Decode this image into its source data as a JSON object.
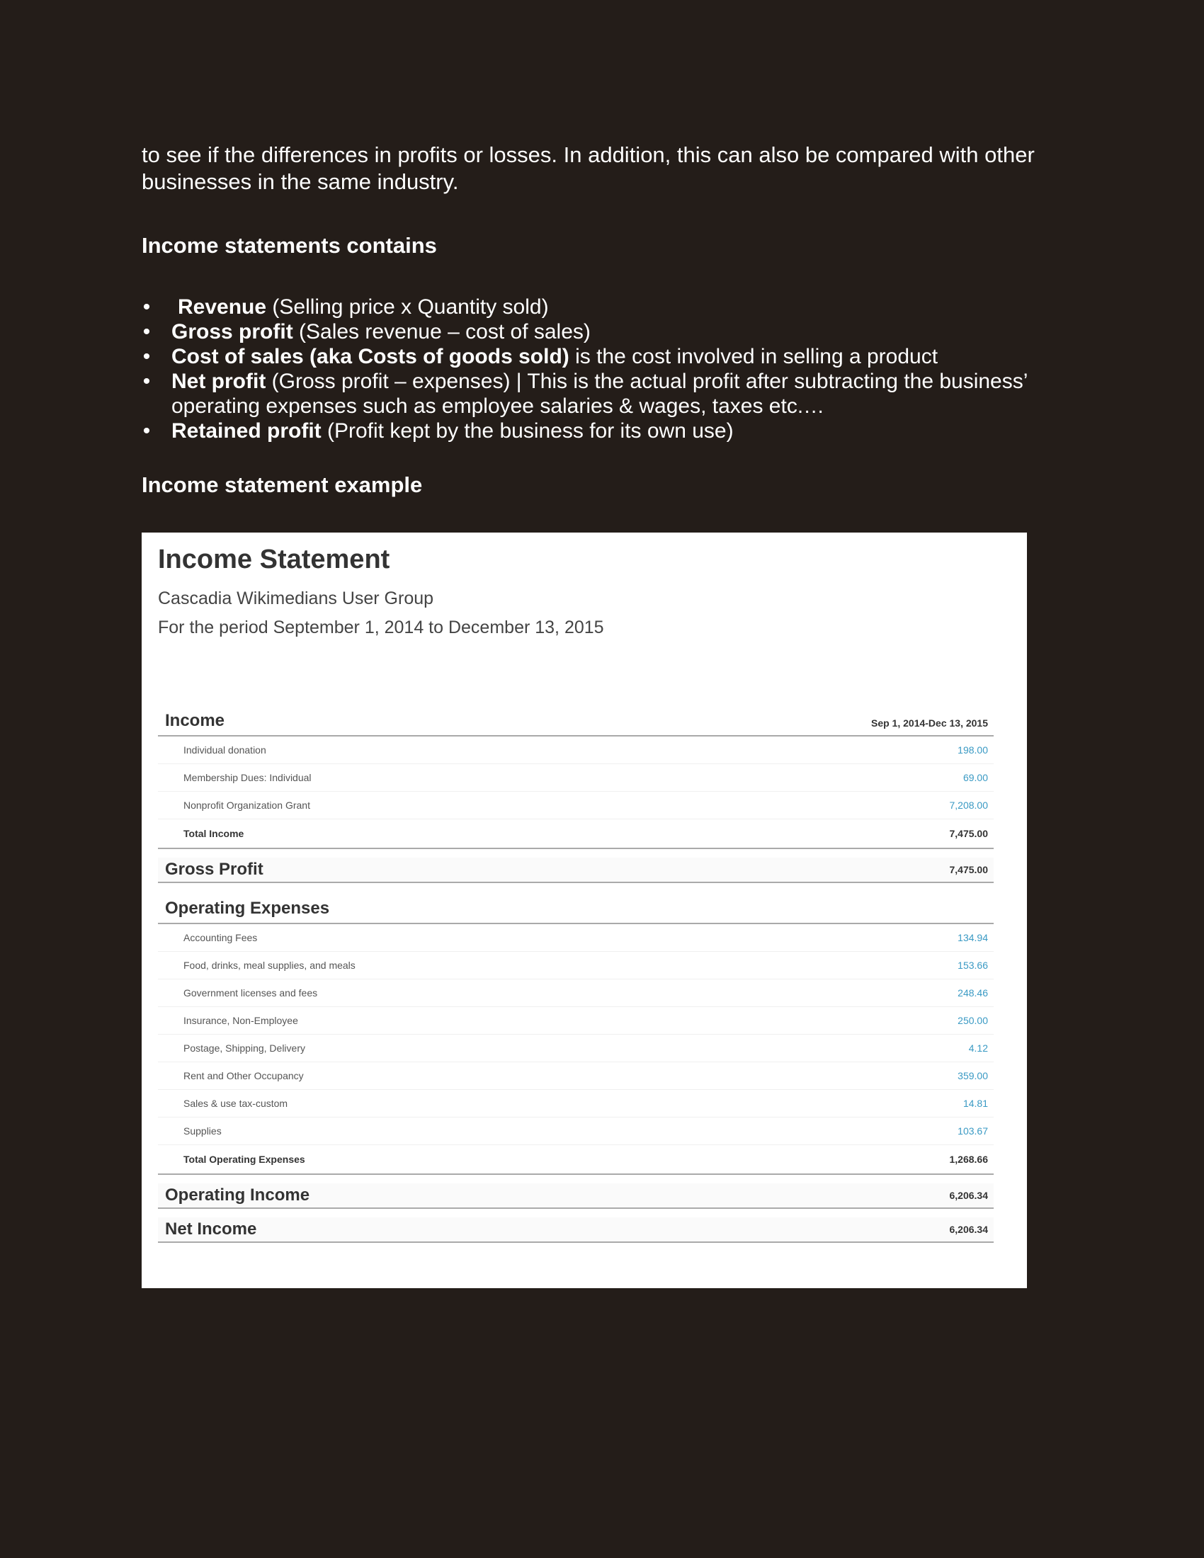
{
  "intro": "to see if the differences in profits or losses. In addition, this can also be compared with other businesses in the same industry.",
  "headings": {
    "contains": "Income statements contains",
    "example": "Income statement example"
  },
  "bullets": [
    {
      "bold": "Revenue",
      "text": " (Selling price x Quantity sold)"
    },
    {
      "bold": "Gross profit",
      "text": " (Sales revenue – cost of sales)"
    },
    {
      "bold": "Cost of sales (aka Costs of goods sold)",
      "text": " is the cost involved in selling a product"
    },
    {
      "bold": "Net profit",
      "text": " (Gross profit – expenses) | This is the actual profit after subtracting the business’ operating expenses such as employee salaries & wages, taxes etc.…"
    },
    {
      "bold": "Retained profit",
      "text": " (Profit kept by the business for its own use)"
    }
  ],
  "statement": {
    "title": "Income Statement",
    "organization": "Cascadia Wikimedians User Group",
    "period": "For the period September 1, 2014 to December 13, 2015",
    "column_header": "Sep 1, 2014-Dec 13, 2015",
    "income": {
      "label": "Income",
      "items": [
        {
          "label": "Individual donation",
          "amount": "198.00"
        },
        {
          "label": "Membership Dues: Individual",
          "amount": "69.00"
        },
        {
          "label": "Nonprofit Organization Grant",
          "amount": "7,208.00"
        }
      ],
      "total_label": "Total Income",
      "total_amount": "7,475.00"
    },
    "gross_profit": {
      "label": "Gross Profit",
      "amount": "7,475.00"
    },
    "operating_expenses": {
      "label": "Operating Expenses",
      "items": [
        {
          "label": "Accounting Fees",
          "amount": "134.94"
        },
        {
          "label": "Food, drinks, meal supplies, and meals",
          "amount": "153.66"
        },
        {
          "label": "Government licenses and fees",
          "amount": "248.46"
        },
        {
          "label": "Insurance, Non-Employee",
          "amount": "250.00"
        },
        {
          "label": "Postage, Shipping, Delivery",
          "amount": "4.12"
        },
        {
          "label": "Rent and Other Occupancy",
          "amount": "359.00"
        },
        {
          "label": "Sales & use tax-custom",
          "amount": "14.81"
        },
        {
          "label": "Supplies",
          "amount": "103.67"
        }
      ],
      "total_label": "Total Operating Expenses",
      "total_amount": "1,268.66"
    },
    "operating_income": {
      "label": "Operating Income",
      "amount": "6,206.34"
    },
    "net_income": {
      "label": "Net Income",
      "amount": "6,206.34"
    }
  }
}
